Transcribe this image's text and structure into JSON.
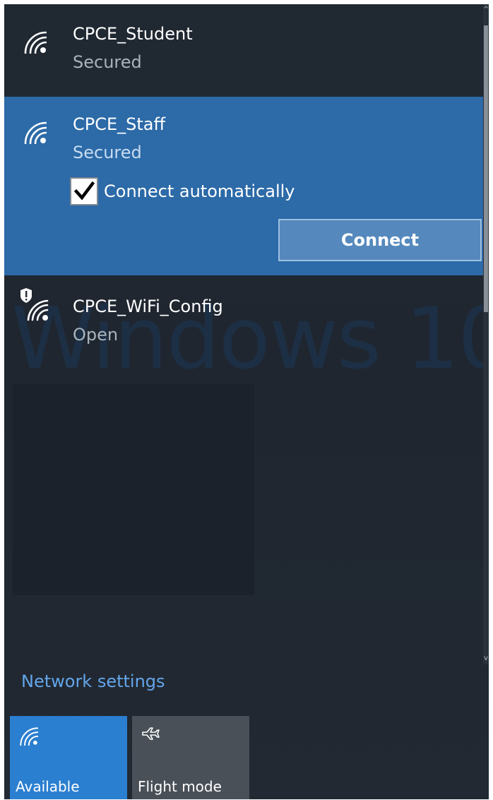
{
  "networks": [
    {
      "name": "CPCE_Student",
      "status": "Secured",
      "icon": "wifi-signal-icon"
    },
    {
      "name": "CPCE_Staff",
      "status": "Secured",
      "icon": "wifi-signal-icon",
      "connect_automatically": {
        "label": "Connect automatically",
        "checked": true
      },
      "connect_label": "Connect"
    },
    {
      "name": "CPCE_WiFi_Config",
      "status": "Open",
      "icon": "wifi-shield-warning-icon"
    }
  ],
  "background_watermark": "Windows 10",
  "network_settings_label": "Network settings",
  "quick_actions": [
    {
      "label": "Available",
      "icon": "wifi-signal-icon",
      "active": true
    },
    {
      "label": "Flight mode",
      "icon": "airplane-icon",
      "active": false
    }
  ],
  "colors": {
    "accent": "#2b7fd0",
    "selected_row": "#2c6aa8",
    "link": "#63a6ea"
  }
}
